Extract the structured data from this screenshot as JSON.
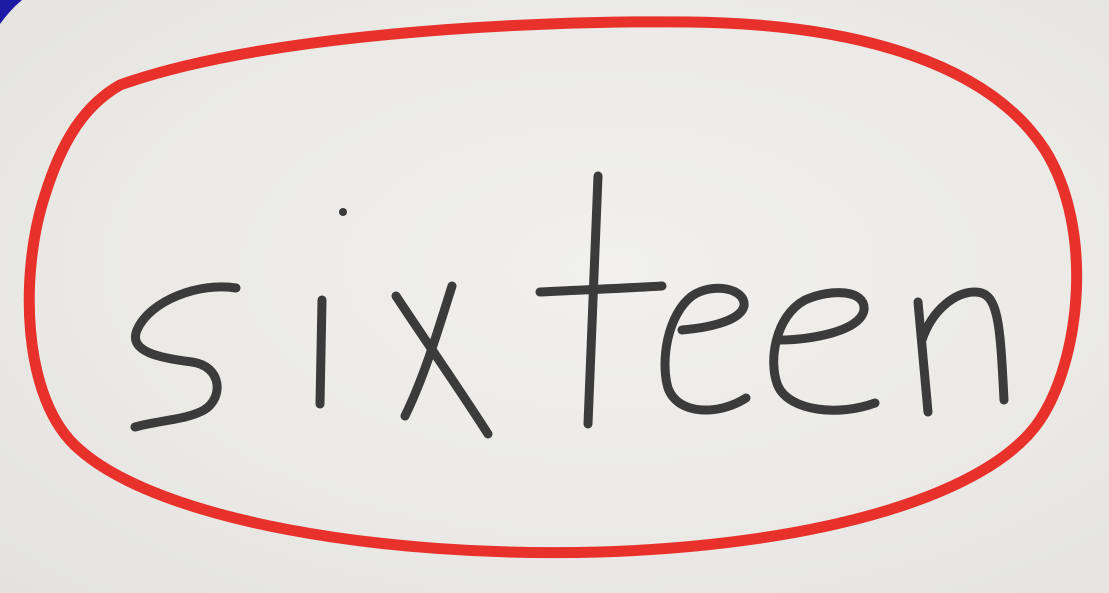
{
  "card": {
    "word": "sixteen",
    "ink_color": "#3b3b3b",
    "circle_color": "#e8312b",
    "corner_marker_color": "#1d1aa6",
    "paper_color": "#ecebe8"
  }
}
